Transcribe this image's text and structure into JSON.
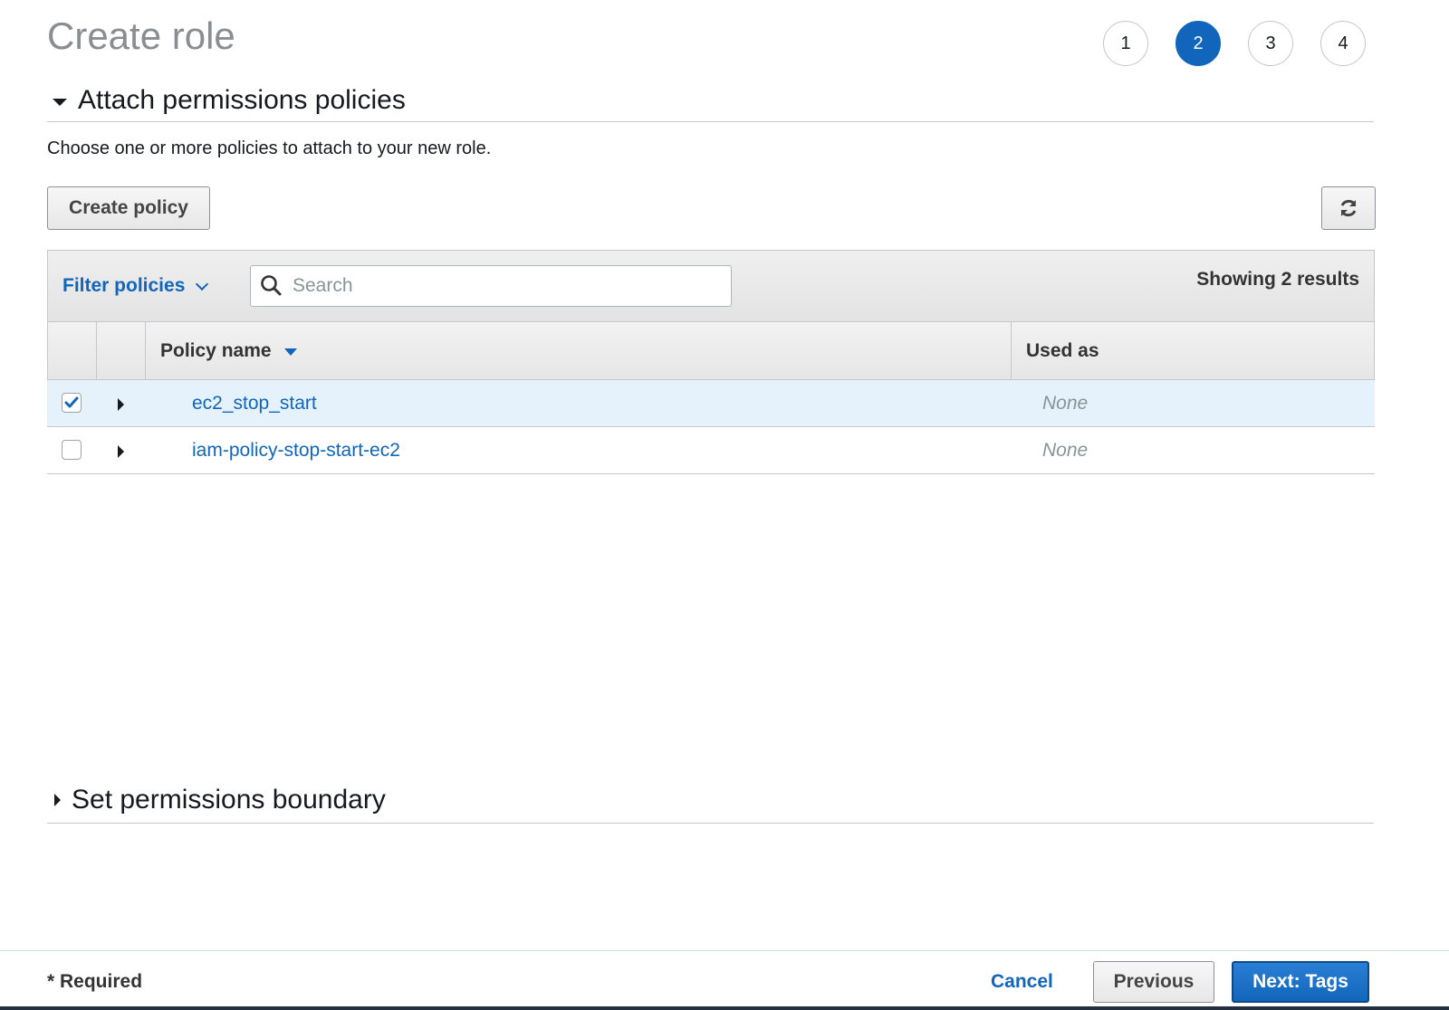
{
  "page_title": "Create role",
  "steps": [
    {
      "label": "1",
      "active": false
    },
    {
      "label": "2",
      "active": true
    },
    {
      "label": "3",
      "active": false
    },
    {
      "label": "4",
      "active": false
    }
  ],
  "attach_section": {
    "title": "Attach permissions policies",
    "expanded": true,
    "description": "Choose one or more policies to attach to your new role.",
    "create_policy_label": "Create policy",
    "refresh_icon": "refresh-icon"
  },
  "table": {
    "filter_label": "Filter policies",
    "search": {
      "placeholder": "Search",
      "value": ""
    },
    "results_text": "Showing 2 results",
    "columns": [
      "Policy name",
      "Used as"
    ],
    "sort_column": "Policy name",
    "rows": [
      {
        "name": "ec2_stop_start",
        "used_as": "None",
        "checked": true
      },
      {
        "name": "iam-policy-stop-start-ec2",
        "used_as": "None",
        "checked": false
      }
    ]
  },
  "boundary_section": {
    "title": "Set permissions boundary",
    "expanded": false
  },
  "footer": {
    "required_text": "* Required",
    "cancel_label": "Cancel",
    "previous_label": "Previous",
    "next_label": "Next: Tags"
  },
  "colors": {
    "accent": "#1166bb",
    "selected_row": "#e6f2fb",
    "title_gray": "#8a8d91"
  }
}
